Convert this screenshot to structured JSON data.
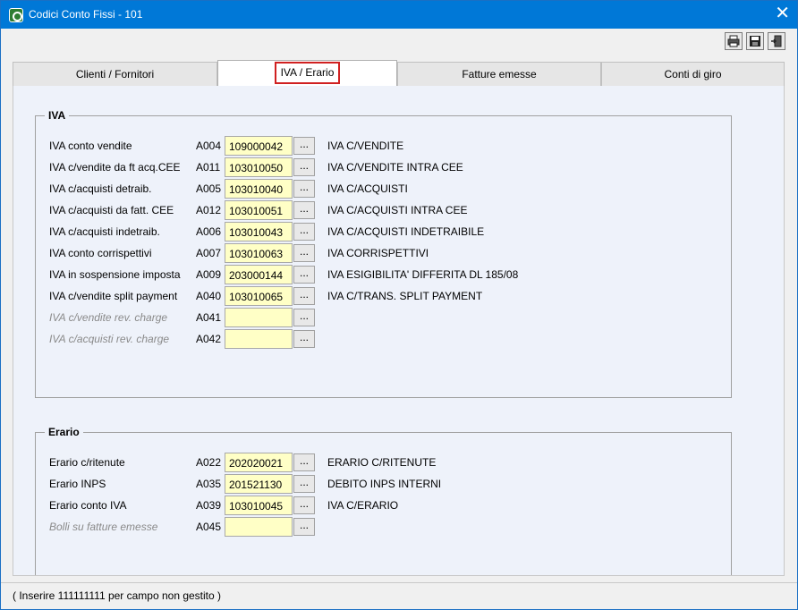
{
  "window": {
    "title": "Codici Conto Fissi - 101"
  },
  "tabs": [
    {
      "label": "Clienti / Fornitori"
    },
    {
      "label": "IVA / Erario"
    },
    {
      "label": "Fatture emesse"
    },
    {
      "label": "Conti di giro"
    }
  ],
  "iva": {
    "title": "IVA",
    "rows": [
      {
        "label": "IVA conto vendite",
        "code": "A004",
        "value": "109000042",
        "description": "IVA C/VENDITE"
      },
      {
        "label": "IVA c/vendite da ft acq.CEE",
        "code": "A011",
        "value": "103010050",
        "description": "IVA C/VENDITE INTRA CEE"
      },
      {
        "label": "IVA c/acquisti detraib.",
        "code": "A005",
        "value": "103010040",
        "description": "IVA C/ACQUISTI"
      },
      {
        "label": "IVA c/acquisti da fatt. CEE",
        "code": "A012",
        "value": "103010051",
        "description": "IVA C/ACQUISTI INTRA CEE"
      },
      {
        "label": "IVA c/acquisti indetraib.",
        "code": "A006",
        "value": "103010043",
        "description": "IVA C/ACQUISTI INDETRAIBILE"
      },
      {
        "label": "IVA conto corrispettivi",
        "code": "A007",
        "value": "103010063",
        "description": "IVA CORRISPETTIVI"
      },
      {
        "label": "IVA in sospensione imposta",
        "code": "A009",
        "value": "203000144",
        "description": "IVA ESIGIBILITA' DIFFERITA DL 185/08"
      },
      {
        "label": "IVA c/vendite split payment",
        "code": "A040",
        "value": "103010065",
        "description": "IVA C/TRANS. SPLIT PAYMENT"
      },
      {
        "label": "IVA c/vendite rev. charge",
        "code": "A041",
        "value": "",
        "description": ""
      },
      {
        "label": "IVA c/acquisti rev. charge",
        "code": "A042",
        "value": "",
        "description": ""
      }
    ]
  },
  "erario": {
    "title": "Erario",
    "rows": [
      {
        "label": "Erario c/ritenute",
        "code": "A022",
        "value": "202020021",
        "description": "ERARIO C/RITENUTE"
      },
      {
        "label": "Erario INPS",
        "code": "A035",
        "value": "201521130",
        "description": "DEBITO INPS INTERNI"
      },
      {
        "label": "Erario conto IVA",
        "code": "A039",
        "value": "103010045",
        "description": "IVA C/ERARIO"
      },
      {
        "label": "Bolli su fatture emesse",
        "code": "A045",
        "value": "",
        "description": ""
      }
    ]
  },
  "lookup_button_label": "...",
  "status": "( Inserire 111111111 per campo non gestito )"
}
